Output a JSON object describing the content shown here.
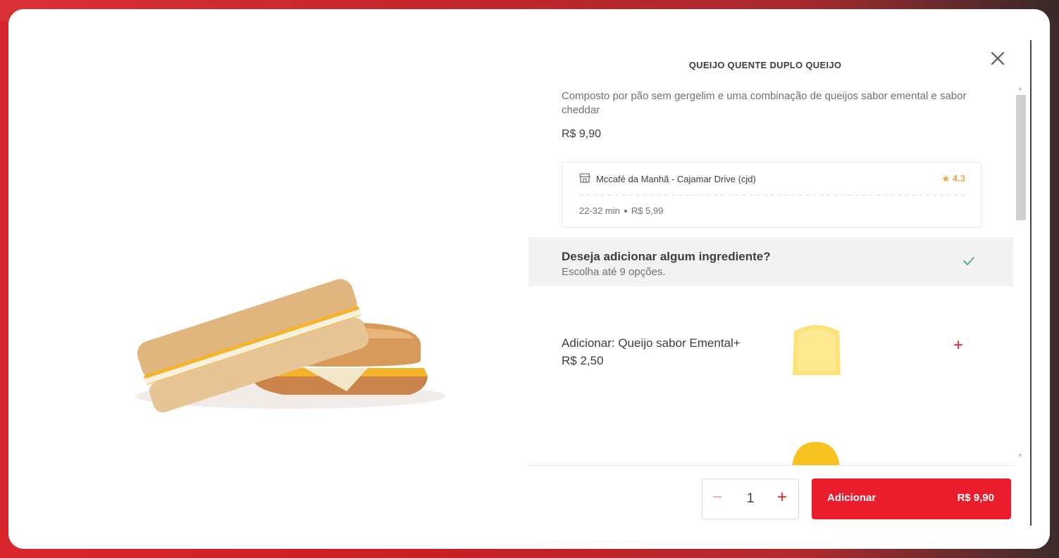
{
  "product": {
    "title": "QUEIJO QUENTE DUPLO QUEIJO",
    "description": "Composto por pão sem gergelim e uma combinação de queijos sabor emental e sabor cheddar",
    "price": "R$ 9,90"
  },
  "store": {
    "name": "Mccafé da Manhã - Cajamar Drive (cjd)",
    "rating": "4.3",
    "delivery_time": "22-32 min",
    "delivery_fee": "R$ 5,99"
  },
  "section": {
    "title": "Deseja adicionar algum ingrediente?",
    "subtitle": "Escolha até 9 opções."
  },
  "options": [
    {
      "label": "Adicionar: Queijo sabor Emental+ R$ 2,50"
    }
  ],
  "footer": {
    "quantity": "1",
    "add_label": "Adicionar",
    "add_price": "R$ 9,90"
  },
  "icons": {
    "close": "close-icon",
    "store": "store-icon",
    "star": "star-icon",
    "check": "check-icon",
    "plus": "plus-icon",
    "minus": "minus-icon"
  },
  "colors": {
    "accent": "#ea1d2c",
    "rating": "#e7a74e",
    "text": "#3e3e3e",
    "muted": "#717171"
  }
}
